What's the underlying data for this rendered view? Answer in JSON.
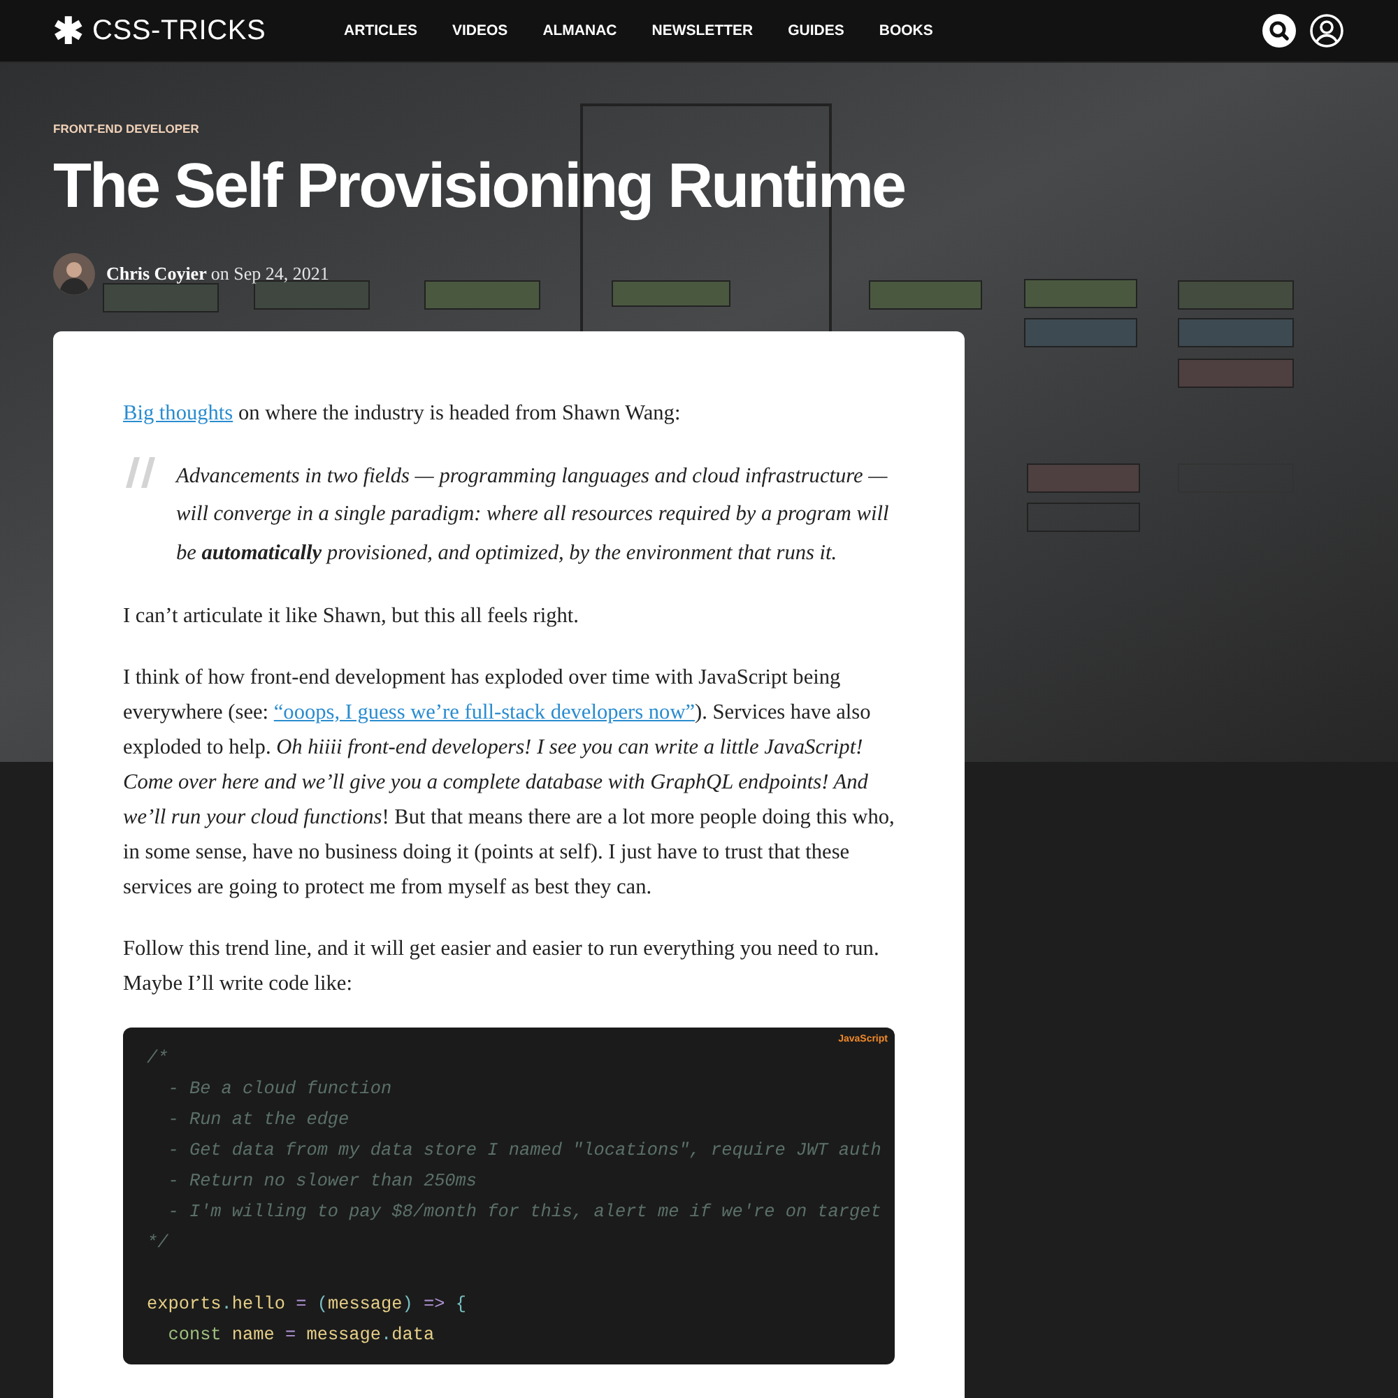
{
  "header": {
    "logo_mark": "✱",
    "logo_text": "CSS-TRICKS",
    "nav": [
      "ARTICLES",
      "VIDEOS",
      "ALMANAC",
      "NEWSLETTER",
      "GUIDES",
      "BOOKS"
    ]
  },
  "hero": {
    "kind": "picture",
    "category": "FRONT-END DEVELOPER",
    "title": "The Self Provisioning Runtime",
    "author": "Chris Coyier",
    "date_prefix": "on",
    "date": "Sep 24, 2021"
  },
  "article": {
    "blocks": [
      {
        "kind": "paragraph",
        "parts": [
          {
            "kind": "link",
            "text": "Big thoughts"
          },
          {
            "kind": "text",
            "text": " on where the industry is headed from Shawn Wang:"
          }
        ]
      },
      {
        "kind": "quote",
        "text": "Advancements in two fields — programming languages and cloud infrastructure — will converge in a single paradigm: where all resources required by a program will be **automatically** provisioned, and optimized, by the environment that runs it."
      },
      {
        "kind": "paragraph",
        "parts": [
          {
            "kind": "text",
            "text": "I can’t articulate it like Shawn, but this all feels right."
          }
        ]
      },
      {
        "kind": "paragraph",
        "parts": [
          {
            "kind": "text",
            "text": "I think of how front-end development has exploded over time with JavaScript being everywhere (see: "
          },
          {
            "kind": "link",
            "text": "“ooops, I guess we’re full-stack developers now”"
          },
          {
            "kind": "text",
            "text": "). Services have also exploded to help. *Oh hiiii front-end developers! I see you can write a little JavaScript! Come over here and we’ll give you a complete database with GraphQL endpoints! And we’ll run your cloud functions*! But that means there are a lot more people doing this who, in some sense, have no business doing it (points at self). I just have to trust that these services are going to protect me from myself as best they can."
          }
        ]
      },
      {
        "kind": "paragraph",
        "parts": [
          {
            "kind": "text",
            "text": "Follow this trend line, and it will get easier and easier to run everything you need to run. Maybe I’ll write code like:"
          }
        ]
      }
    ],
    "code": {
      "language": "JavaScript",
      "lines": [
        {
          "tokens": [
            {
              "kind": "comment",
              "text": "/*"
            }
          ]
        },
        {
          "tokens": [
            {
              "kind": "comment",
              "text": "  - Be a cloud function"
            }
          ]
        },
        {
          "tokens": [
            {
              "kind": "comment",
              "text": "  - Run at the edge"
            }
          ]
        },
        {
          "tokens": [
            {
              "kind": "comment",
              "text": "  - Get data from my data store I named \"locations\", require JWT auth"
            }
          ]
        },
        {
          "tokens": [
            {
              "kind": "comment",
              "text": "  - Return no slower than 250ms"
            }
          ]
        },
        {
          "tokens": [
            {
              "kind": "comment",
              "text": "  - I'm willing to pay $8/month for this, alert me if we're on target"
            }
          ]
        },
        {
          "tokens": [
            {
              "kind": "comment",
              "text": "*/"
            }
          ]
        },
        {
          "kind": "blank"
        },
        {
          "tokens": [
            {
              "kind": "name",
              "text": "exports"
            },
            {
              "kind": "punct",
              "text": "."
            },
            {
              "kind": "name",
              "text": "hello"
            },
            {
              "kind": "op",
              "text": " = "
            },
            {
              "kind": "punct",
              "text": "("
            },
            {
              "kind": "name",
              "text": "message"
            },
            {
              "kind": "punct",
              "text": ")"
            },
            {
              "kind": "op",
              "text": " => "
            },
            {
              "kind": "punct",
              "text": "{"
            }
          ]
        },
        {
          "tokens": [
            {
              "kind": "keyword",
              "text": "  const"
            },
            {
              "kind": "name",
              "text": " name"
            },
            {
              "kind": "op",
              "text": " = "
            },
            {
              "kind": "name",
              "text": "message"
            },
            {
              "kind": "punct",
              "text": "."
            },
            {
              "kind": "name",
              "text": "data"
            }
          ]
        }
      ]
    }
  }
}
